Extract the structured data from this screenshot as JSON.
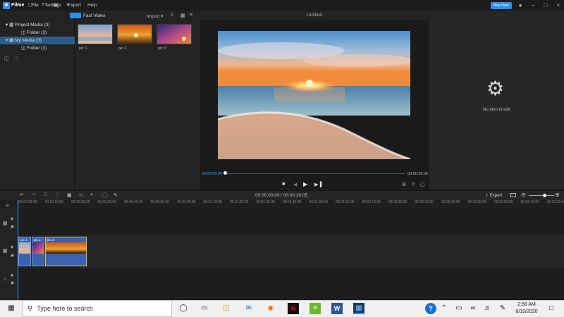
{
  "app": {
    "name": "Filme",
    "menu": [
      "File",
      "Settings",
      "Export",
      "Help"
    ],
    "buy_label": "Buy Now"
  },
  "media": {
    "tree": [
      {
        "label": "Project Media (3)",
        "selected": false
      },
      {
        "label": "Folder (3)",
        "selected": false
      },
      {
        "label": "My Media (3)",
        "selected": true
      },
      {
        "label": "Folder (3)",
        "selected": false
      }
    ],
    "fast_video_label": "Fast Video",
    "import_label": "Import",
    "items": [
      {
        "label": "pic 1"
      },
      {
        "label": "pic 2"
      },
      {
        "label": "pic 3"
      }
    ]
  },
  "preview": {
    "title": "Untitled",
    "current_time": "00:00:00:00",
    "total_time": "00:00:26:05"
  },
  "properties": {
    "empty_text": "No item to edit"
  },
  "timeline": {
    "timecode": "00:00:00:00  /  00:00:26:05",
    "export_label": "Export",
    "ticks": [
      "00:00:00:00",
      "00:00:10:00",
      "00:00:20:00",
      "00:00:30:00",
      "00:00:40:00",
      "00:00:50:00",
      "00:01:00:00",
      "00:01:10:00",
      "00:01:20:00",
      "00:01:30:00",
      "00:01:40:00",
      "00:01:50:00",
      "00:02:00:00",
      "00:02:10:00",
      "00:02:20:00",
      "00:02:30:00",
      "00:02:40:00",
      "00:02:50:00",
      "00:03:00:00",
      "00:03:10:00",
      "00:03:20:00"
    ],
    "clips": [
      {
        "label": "pic 1"
      },
      {
        "label": "pic 2"
      },
      {
        "label": "pic 3"
      }
    ]
  },
  "taskbar": {
    "search_placeholder": "Type here to search",
    "time": "2:56 AM",
    "date": "8/15/2020"
  },
  "colors": {
    "accent": "#2e8ef0",
    "selection": "#2c5d8a",
    "clip": "#3b63ad",
    "playhead": "#2ea8ff"
  }
}
